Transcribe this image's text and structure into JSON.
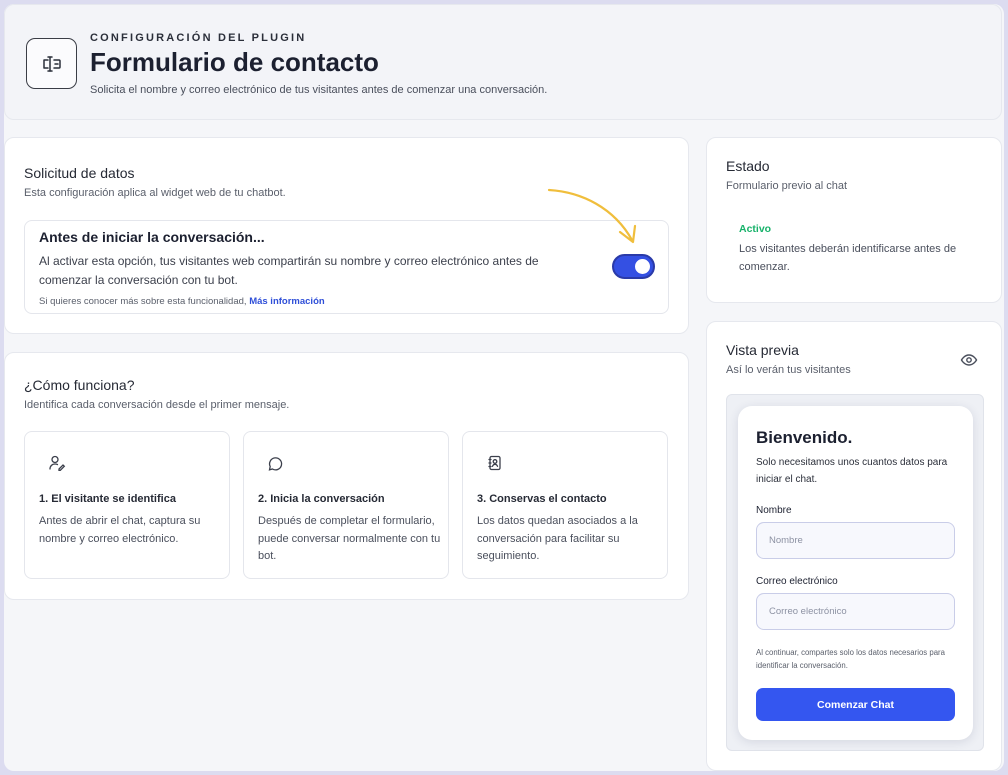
{
  "header": {
    "eyebrow": "CONFIGURACIÓN DEL PLUGIN",
    "title": "Formulario de contacto",
    "subtitle": "Solicita el nombre y correo electrónico de tus visitantes antes de comenzar una conversación.",
    "icon": "form-icon"
  },
  "solicitud": {
    "title": "Solicitud de datos",
    "subtitle": "Esta configuración aplica al widget web de tu chatbot.",
    "option": {
      "title": "Antes de iniciar la conversación...",
      "description": "Al activar esta opción, tus visitantes web compartirán su nombre y correo electrónico antes de comenzar la conversación con tu bot.",
      "note_prefix": "Si quieres conocer más sobre esta funcionalidad,",
      "note_link": "Más información",
      "enabled": true
    },
    "accent": "#3450e3"
  },
  "como": {
    "title": "¿Cómo funciona?",
    "subtitle": "Identifica cada conversación desde el primer mensaje.",
    "steps": [
      {
        "icon": "user-edit-icon",
        "title": "1. El visitante se identifica",
        "desc": "Antes de abrir el chat, captura su nombre y correo electrónico."
      },
      {
        "icon": "chat-bubble-icon",
        "title": "2. Inicia la conversación",
        "desc": "Después de completar el formulario, puede conversar normalmente con tu bot."
      },
      {
        "icon": "contact-book-icon",
        "title": "3. Conservas el contacto",
        "desc": "Los datos quedan asociados a la conversación para facilitar su seguimiento."
      }
    ]
  },
  "estado": {
    "title": "Estado",
    "subtitle": "Formulario previo al chat",
    "status": "Activo",
    "status_color": "#17b26a",
    "desc": "Los visitantes deberán identificarse antes de comenzar."
  },
  "preview": {
    "title": "Vista previa",
    "subtitle": "Así lo verán tus visitantes",
    "icon": "eye-icon",
    "form": {
      "title": "Bienvenido.",
      "subtitle": "Solo necesitamos unos cuantos datos para iniciar el chat.",
      "name_label": "Nombre",
      "name_placeholder": "Nombre",
      "email_label": "Correo electrónico",
      "email_placeholder": "Correo electrónico",
      "note": "Al continuar, compartes solo los datos necesarios para identificar la conversación.",
      "button": "Comenzar Chat",
      "button_color": "#3456f0"
    }
  }
}
